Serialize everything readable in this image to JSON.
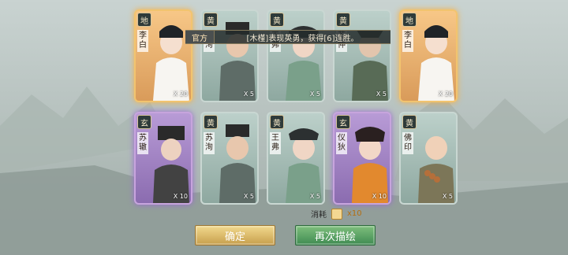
{
  "banner": {
    "tag": "官方",
    "message": "[木槿]表现英勇，获得[6]连胜。"
  },
  "cards": [
    {
      "rank": "地",
      "name": "李白",
      "count": "X 20",
      "variant": "gold"
    },
    {
      "rank": "黄",
      "name": "苏洵",
      "count": "X 5",
      "variant": "normal"
    },
    {
      "rank": "黄",
      "name": "王弗",
      "count": "X 5",
      "variant": "normal"
    },
    {
      "rank": "黄",
      "name": "苏仲",
      "count": "X 5",
      "variant": "normal"
    },
    {
      "rank": "地",
      "name": "李白",
      "count": "X 20",
      "variant": "gold"
    },
    {
      "rank": "玄",
      "name": "苏辙",
      "count": "X 10",
      "variant": "purple"
    },
    {
      "rank": "黄",
      "name": "苏洵",
      "count": "X 5",
      "variant": "normal"
    },
    {
      "rank": "黄",
      "name": "王弗",
      "count": "X 5",
      "variant": "normal"
    },
    {
      "rank": "玄",
      "name": "仪狄",
      "count": "X 10",
      "variant": "purple"
    },
    {
      "rank": "黄",
      "name": "佛印",
      "count": "X 5",
      "variant": "normal"
    }
  ],
  "cost": {
    "label": "消耗",
    "multiplier": "x10"
  },
  "buttons": {
    "confirm": "确定",
    "redraw": "再次描绘"
  }
}
